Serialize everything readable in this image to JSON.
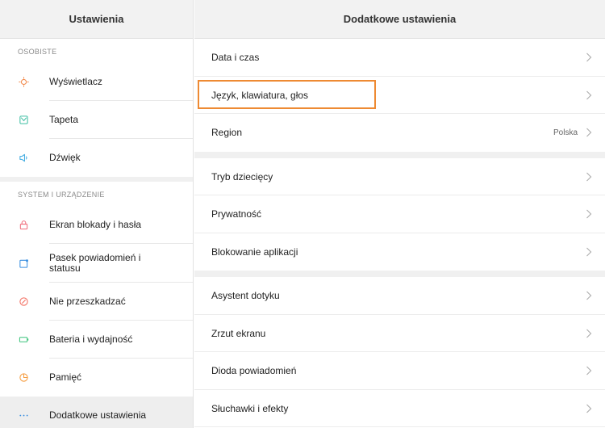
{
  "left_pane": {
    "title": "Ustawienia",
    "sections": [
      {
        "label": "OSOBISTE",
        "items": [
          {
            "label": "Wyświetlacz",
            "icon": "brightness-icon",
            "icon_color": "#f2894b"
          },
          {
            "label": "Tapeta",
            "icon": "wallpaper-icon",
            "icon_color": "#3fbfa3"
          },
          {
            "label": "Dźwięk",
            "icon": "speaker-icon",
            "icon_color": "#3aa9e0"
          }
        ]
      },
      {
        "label": "SYSTEM I URZĄDZENIE",
        "items": [
          {
            "label": "Ekran blokady i hasła",
            "icon": "lock-icon",
            "icon_color": "#f06b7a"
          },
          {
            "label": "Pasek powiadomień i statusu",
            "icon": "notification-bar-icon",
            "icon_color": "#3a8fe0"
          },
          {
            "label": "Nie przeszkadzać",
            "icon": "do-not-disturb-icon",
            "icon_color": "#f26a5c"
          },
          {
            "label": "Bateria i wydajność",
            "icon": "battery-icon",
            "icon_color": "#3cc47b"
          },
          {
            "label": "Pamięć",
            "icon": "storage-icon",
            "icon_color": "#f59a3c"
          },
          {
            "label": "Dodatkowe ustawienia",
            "icon": "more-dots-icon",
            "icon_color": "#3a8fe0"
          }
        ]
      }
    ]
  },
  "right_pane": {
    "title": "Dodatkowe ustawienia",
    "groups": [
      [
        {
          "label": "Data i czas",
          "value": ""
        },
        {
          "label": "Język, klawiatura, głos",
          "value": ""
        },
        {
          "label": "Region",
          "value": "Polska"
        }
      ],
      [
        {
          "label": "Tryb dziecięcy",
          "value": ""
        },
        {
          "label": "Prywatność",
          "value": ""
        },
        {
          "label": "Blokowanie aplikacji",
          "value": ""
        }
      ],
      [
        {
          "label": "Asystent dotyku",
          "value": ""
        },
        {
          "label": "Zrzut ekranu",
          "value": ""
        },
        {
          "label": "Dioda powiadomień",
          "value": ""
        },
        {
          "label": "Słuchawki i efekty",
          "value": ""
        }
      ]
    ]
  },
  "highlight_color": "#ee8a33",
  "active_item_color": "#eeeeee"
}
